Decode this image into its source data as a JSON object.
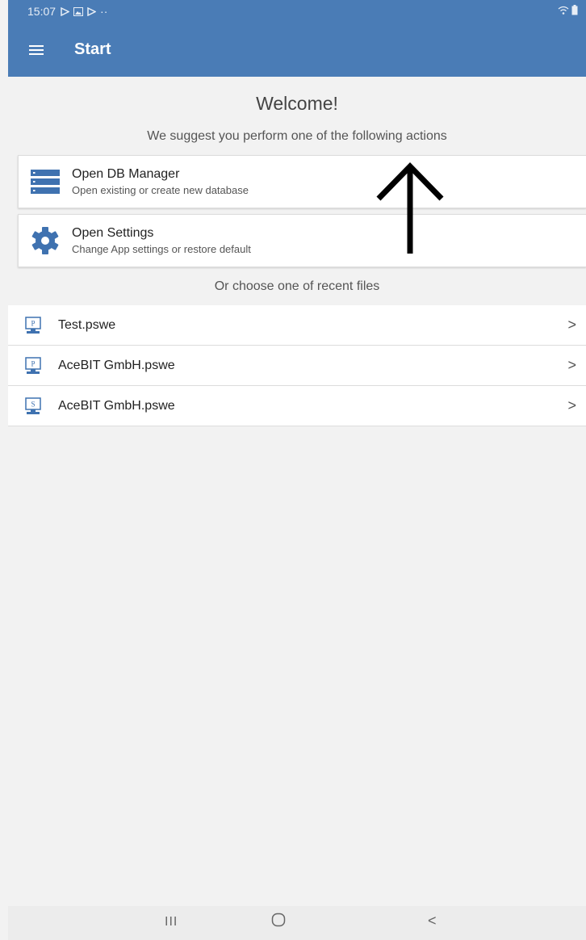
{
  "status_bar": {
    "time": "15:07",
    "notification_icons": [
      "play-store-icon",
      "gallery-icon",
      "play-store-icon"
    ],
    "more": "··"
  },
  "app_bar": {
    "title": "Start"
  },
  "welcome": {
    "heading": "Welcome!",
    "subtitle": "We suggest you perform one of the following actions"
  },
  "actions": [
    {
      "title": "Open DB Manager",
      "subtitle": "Open existing or create new database",
      "icon": "database-icon"
    },
    {
      "title": "Open Settings",
      "subtitle": "Change App settings or restore default",
      "icon": "gear-icon"
    }
  ],
  "recent": {
    "label": "Or choose one of recent files",
    "files": [
      {
        "name": "Test.pswe",
        "badge": "P"
      },
      {
        "name": "AceBIT GmbH.pswe",
        "badge": "P"
      },
      {
        "name": "AceBIT GmbH.pswe",
        "badge": "S"
      }
    ],
    "chevron": ">"
  },
  "nav_bar": {
    "recents": "III",
    "home": "O",
    "back": "<"
  },
  "colors": {
    "primary": "#4a7cb6",
    "background": "#f2f2f2",
    "card": "#ffffff"
  }
}
